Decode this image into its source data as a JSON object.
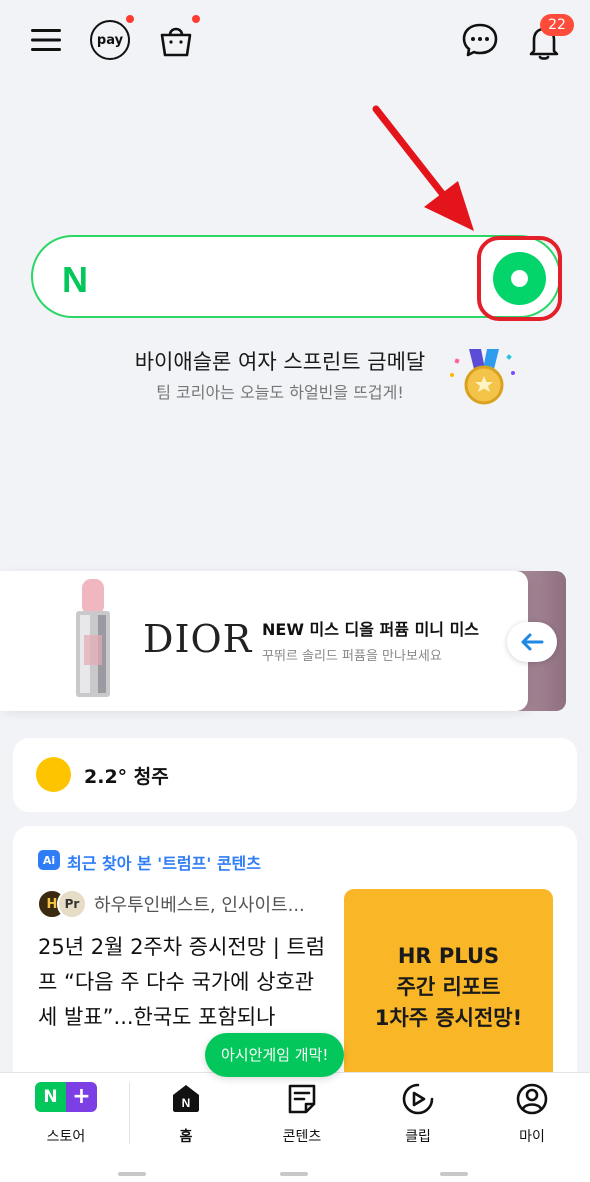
{
  "topbar": {
    "pay_label": "pay",
    "notification_count": "22"
  },
  "promo": {
    "title": "바이애슬론 여자 스프린트 금메달",
    "subtitle": "팀 코리아는 오늘도 하얼빈을 뜨겁게!"
  },
  "ad": {
    "brand": "DIOR",
    "title": "NEW 미스 디올 퍼퓸 미니 미스",
    "subtitle": "꾸뛰르 솔리드 퍼퓸을 만나보세요"
  },
  "weather": {
    "text": "2.2° 청주"
  },
  "content": {
    "ai_badge": "Ai",
    "recent_label": "최근 찾아 본 '트럼프' 콘텐츠",
    "avatar_a": "H",
    "avatar_b": "Pr",
    "source": "하우투인베스트, 인사이트...",
    "headline": "25년 2월 2주차 증시전망 | 트럼프 “다음 주 다수 국가에 상호관세 발표”...한국도 포함되나",
    "thumb_lines": [
      "HR PLUS",
      "주간 리포트",
      "1차주 증시전망!"
    ],
    "floating_pill": "아시안게임 개막!"
  },
  "bottom_nav": {
    "store_badge": "N",
    "store": "스토어",
    "home": "홈",
    "contents": "콘텐츠",
    "clip": "클립",
    "my": "마이"
  },
  "colors": {
    "naver_green": "#03c75a",
    "accent_blue": "#2f7df6",
    "alert_red": "#ff3b30",
    "thumb_yellow": "#f9b626"
  }
}
